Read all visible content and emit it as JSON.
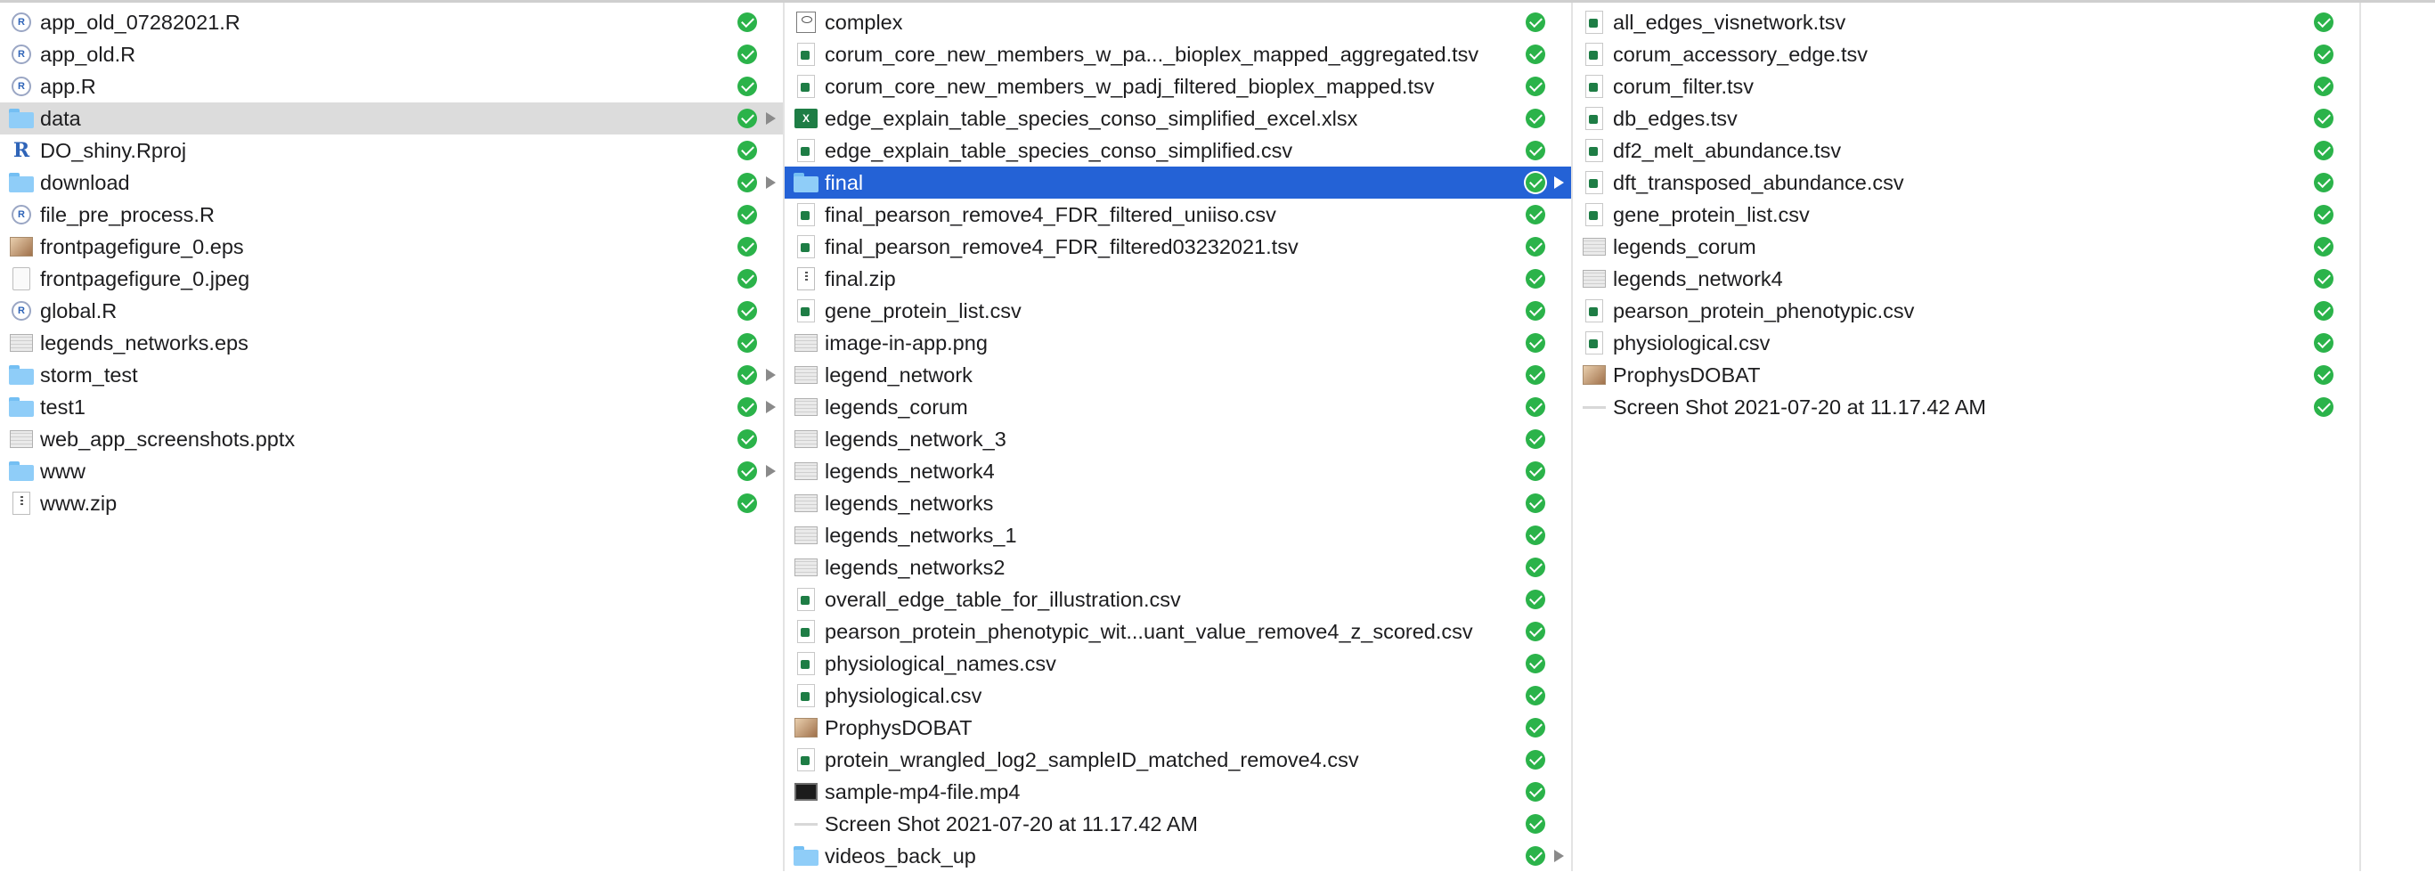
{
  "columns": [
    {
      "items": [
        {
          "name": "app_old_07282021.R",
          "icon": "r-script-icon",
          "folder": false,
          "selected": ""
        },
        {
          "name": "app_old.R",
          "icon": "r-script-icon",
          "folder": false,
          "selected": ""
        },
        {
          "name": "app.R",
          "icon": "r-script-icon",
          "folder": false,
          "selected": ""
        },
        {
          "name": "data",
          "icon": "folder-icon",
          "folder": true,
          "selected": "inactive"
        },
        {
          "name": "DO_shiny.Rproj",
          "icon": "rproj-icon",
          "folder": false,
          "selected": ""
        },
        {
          "name": "download",
          "icon": "folder-icon",
          "folder": true,
          "selected": ""
        },
        {
          "name": "file_pre_process.R",
          "icon": "r-script-icon",
          "folder": false,
          "selected": ""
        },
        {
          "name": "frontpagefigure_0.eps",
          "icon": "image-thumbnail-icon",
          "folder": false,
          "selected": ""
        },
        {
          "name": "frontpagefigure_0.jpeg",
          "icon": "jpeg-icon",
          "folder": false,
          "selected": ""
        },
        {
          "name": "global.R",
          "icon": "r-script-icon",
          "folder": false,
          "selected": ""
        },
        {
          "name": "legends_networks.eps",
          "icon": "image-icon",
          "folder": false,
          "selected": ""
        },
        {
          "name": "storm_test",
          "icon": "folder-icon",
          "folder": true,
          "selected": ""
        },
        {
          "name": "test1",
          "icon": "folder-icon",
          "folder": true,
          "selected": ""
        },
        {
          "name": "web_app_screenshots.pptx",
          "icon": "image-icon",
          "folder": false,
          "selected": ""
        },
        {
          "name": "www",
          "icon": "folder-icon",
          "folder": true,
          "selected": ""
        },
        {
          "name": "www.zip",
          "icon": "zip-icon",
          "folder": false,
          "selected": ""
        }
      ]
    },
    {
      "items": [
        {
          "name": "complex",
          "icon": "document-icon",
          "folder": false,
          "selected": ""
        },
        {
          "name": "corum_core_new_members_w_pa..._bioplex_mapped_aggregated.tsv",
          "icon": "spreadsheet-icon",
          "folder": false,
          "selected": ""
        },
        {
          "name": "corum_core_new_members_w_padj_filtered_bioplex_mapped.tsv",
          "icon": "spreadsheet-icon",
          "folder": false,
          "selected": ""
        },
        {
          "name": "edge_explain_table_species_conso_simplified_excel.xlsx",
          "icon": "excel-icon",
          "folder": false,
          "selected": ""
        },
        {
          "name": "edge_explain_table_species_conso_simplified.csv",
          "icon": "spreadsheet-icon",
          "folder": false,
          "selected": ""
        },
        {
          "name": "final",
          "icon": "folder-icon",
          "folder": true,
          "selected": "active"
        },
        {
          "name": "final_pearson_remove4_FDR_filtered_uniiso.csv",
          "icon": "spreadsheet-icon",
          "folder": false,
          "selected": ""
        },
        {
          "name": "final_pearson_remove4_FDR_filtered03232021.tsv",
          "icon": "spreadsheet-icon",
          "folder": false,
          "selected": ""
        },
        {
          "name": "final.zip",
          "icon": "zip-icon",
          "folder": false,
          "selected": ""
        },
        {
          "name": "gene_protein_list.csv",
          "icon": "spreadsheet-icon",
          "folder": false,
          "selected": ""
        },
        {
          "name": "image-in-app.png",
          "icon": "image-icon",
          "folder": false,
          "selected": ""
        },
        {
          "name": "legend_network",
          "icon": "image-icon",
          "folder": false,
          "selected": ""
        },
        {
          "name": "legends_corum",
          "icon": "image-icon",
          "folder": false,
          "selected": ""
        },
        {
          "name": "legends_network_3",
          "icon": "image-icon",
          "folder": false,
          "selected": ""
        },
        {
          "name": "legends_network4",
          "icon": "image-icon",
          "folder": false,
          "selected": ""
        },
        {
          "name": "legends_networks",
          "icon": "image-icon",
          "folder": false,
          "selected": ""
        },
        {
          "name": "legends_networks_1",
          "icon": "image-icon",
          "folder": false,
          "selected": ""
        },
        {
          "name": "legends_networks2",
          "icon": "image-icon",
          "folder": false,
          "selected": ""
        },
        {
          "name": "overall_edge_table_for_illustration.csv",
          "icon": "spreadsheet-icon",
          "folder": false,
          "selected": ""
        },
        {
          "name": "pearson_protein_phenotypic_wit...uant_value_remove4_z_scored.csv",
          "icon": "spreadsheet-icon",
          "folder": false,
          "selected": ""
        },
        {
          "name": "physiological_names.csv",
          "icon": "spreadsheet-icon",
          "folder": false,
          "selected": ""
        },
        {
          "name": "physiological.csv",
          "icon": "spreadsheet-icon",
          "folder": false,
          "selected": ""
        },
        {
          "name": "ProphysDOBAT",
          "icon": "image-thumbnail-icon",
          "folder": false,
          "selected": ""
        },
        {
          "name": "protein_wrangled_log2_sampleID_matched_remove4.csv",
          "icon": "spreadsheet-icon",
          "folder": false,
          "selected": ""
        },
        {
          "name": "sample-mp4-file.mp4",
          "icon": "video-icon",
          "folder": false,
          "selected": ""
        },
        {
          "name": "Screen Shot 2021-07-20 at 11.17.42 AM",
          "icon": "screenshot-icon",
          "folder": false,
          "selected": ""
        },
        {
          "name": "videos_back_up",
          "icon": "folder-icon",
          "folder": true,
          "selected": ""
        }
      ]
    },
    {
      "items": [
        {
          "name": "all_edges_visnetwork.tsv",
          "icon": "spreadsheet-icon",
          "folder": false,
          "selected": ""
        },
        {
          "name": "corum_accessory_edge.tsv",
          "icon": "spreadsheet-icon",
          "folder": false,
          "selected": ""
        },
        {
          "name": "corum_filter.tsv",
          "icon": "spreadsheet-icon",
          "folder": false,
          "selected": ""
        },
        {
          "name": "db_edges.tsv",
          "icon": "spreadsheet-icon",
          "folder": false,
          "selected": ""
        },
        {
          "name": "df2_melt_abundance.tsv",
          "icon": "spreadsheet-icon",
          "folder": false,
          "selected": ""
        },
        {
          "name": "dft_transposed_abundance.csv",
          "icon": "spreadsheet-icon",
          "folder": false,
          "selected": ""
        },
        {
          "name": "gene_protein_list.csv",
          "icon": "spreadsheet-icon",
          "folder": false,
          "selected": ""
        },
        {
          "name": "legends_corum",
          "icon": "image-icon",
          "folder": false,
          "selected": ""
        },
        {
          "name": "legends_network4",
          "icon": "image-icon",
          "folder": false,
          "selected": ""
        },
        {
          "name": "pearson_protein_phenotypic.csv",
          "icon": "spreadsheet-icon",
          "folder": false,
          "selected": ""
        },
        {
          "name": "physiological.csv",
          "icon": "spreadsheet-icon",
          "folder": false,
          "selected": ""
        },
        {
          "name": "ProphysDOBAT",
          "icon": "image-thumbnail-icon",
          "folder": false,
          "selected": ""
        },
        {
          "name": "Screen Shot 2021-07-20 at 11.17.42 AM",
          "icon": "screenshot-icon",
          "folder": false,
          "selected": ""
        }
      ]
    }
  ],
  "colors": {
    "selection_active": "#2462d6",
    "selection_inactive": "#dcdcdc",
    "sync_status": "#2bb34a"
  }
}
